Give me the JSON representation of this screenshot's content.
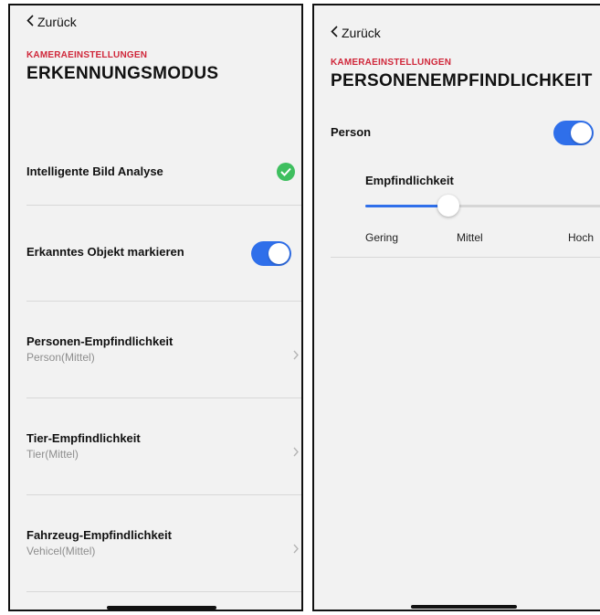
{
  "left": {
    "back_label": "Zurück",
    "eyebrow": "KAMERAEINSTELLUNGEN",
    "title": "ERKENNUNGSMODUS",
    "rows": [
      {
        "label": "Intelligente Bild Analyse"
      },
      {
        "label": "Erkanntes Objekt markieren"
      },
      {
        "label": "Personen-Empfindlichkeit",
        "sub": "Person(Mittel)"
      },
      {
        "label": "Tier-Empfindlichkeit",
        "sub": "Tier(Mittel)"
      },
      {
        "label": "Fahrzeug-Empfindlichkeit",
        "sub": "Vehicel(Mittel)"
      }
    ],
    "analysis_enabled": true,
    "mark_object_on": true
  },
  "right": {
    "back_label": "Zurück",
    "eyebrow": "KAMERAEINSTELLUNGEN",
    "title": "PERSONENEMPFINDLICHKEIT",
    "person_label": "Person",
    "person_on": true,
    "sensitivity_label": "Empfindlichkeit",
    "slider_value": 0.35,
    "ticks": [
      "Gering",
      "Mittel",
      "Hoch"
    ]
  },
  "colors": {
    "accent": "#2f6fea",
    "eyebrow_red": "#d0273a",
    "success_green": "#3fbf5f",
    "background": "#f2f2f2"
  },
  "icons": {
    "back": "chevron-left-icon",
    "row_arrow": "chevron-right-icon",
    "analysis_status": "check-circle-icon"
  }
}
